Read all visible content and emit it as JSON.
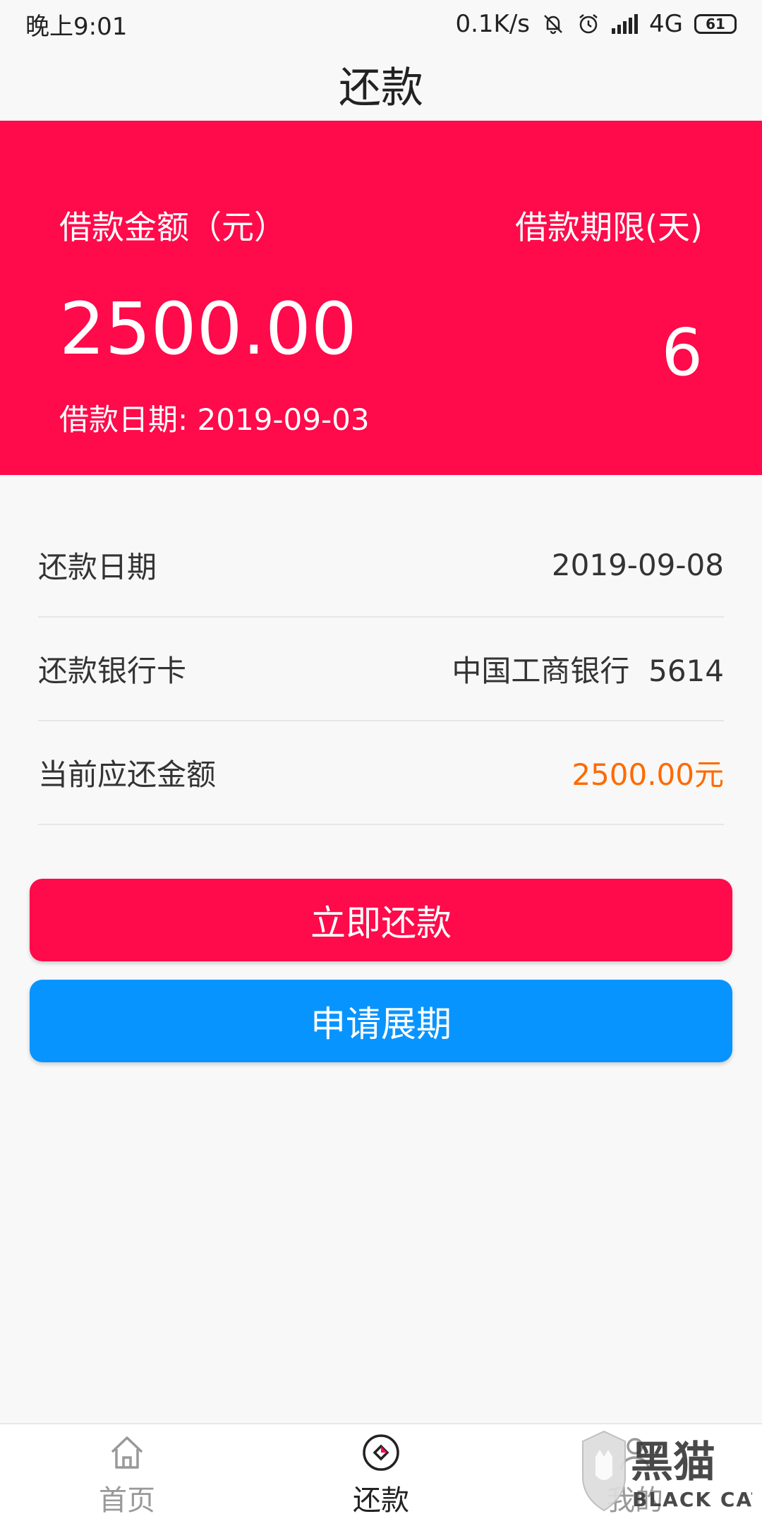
{
  "status_bar": {
    "time": "晚上9:01",
    "net_speed": "0.1K/s",
    "network": "4G",
    "battery": "61"
  },
  "header": {
    "title": "还款"
  },
  "loan_card": {
    "amount_label": "借款金额（元）",
    "amount": "2500.00",
    "term_label": "借款期限(天)",
    "term": "6",
    "date_text": "借款日期: 2019-09-03"
  },
  "info_rows": [
    {
      "label": "还款日期",
      "value": "2019-09-08"
    },
    {
      "label": "还款银行卡",
      "value": "中国工商银行  5614"
    },
    {
      "label": "当前应还金额",
      "value": "2500.00元"
    }
  ],
  "buttons": {
    "repay": "立即还款",
    "extend": "申请展期"
  },
  "tabs": [
    {
      "label": "首页",
      "icon": "home-icon"
    },
    {
      "label": "还款",
      "icon": "repay-icon"
    },
    {
      "label": "我的",
      "icon": "user-icon"
    }
  ],
  "watermark": {
    "brand": "黑猫",
    "sub": "BLACK CAT"
  },
  "colors": {
    "primary": "#ff0a4a",
    "secondary": "#0894ff",
    "accent": "#ff6a00"
  }
}
